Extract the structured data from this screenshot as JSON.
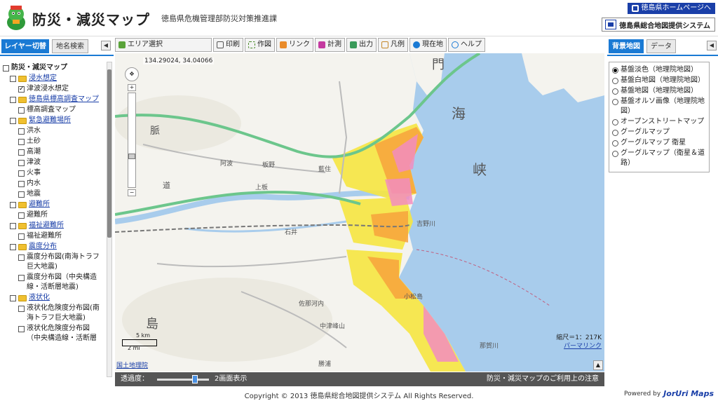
{
  "header": {
    "app_title": "防災・減災マップ",
    "department": "徳島県危機管理部防災対策推進課",
    "home_link": "徳島県ホームページへ",
    "gis_banner": "徳島県総合地図提供システム"
  },
  "left_tabs": {
    "layer_switch": "レイヤー切替",
    "place_search": "地名検索",
    "collapse": "◀"
  },
  "layer_tree": [
    {
      "label": "防災・減災マップ",
      "level": 0,
      "type": "checkbox",
      "checked": false,
      "link": false
    },
    {
      "label": "浸水想定",
      "level": 1,
      "type": "folder",
      "checked": false,
      "link": true
    },
    {
      "label": "津波浸水想定",
      "level": 2,
      "type": "checkbox",
      "checked": true,
      "link": false
    },
    {
      "label": "徳島県標高調査マップ",
      "level": 1,
      "type": "folder",
      "checked": false,
      "link": true
    },
    {
      "label": "標高調査マップ",
      "level": 2,
      "type": "checkbox",
      "checked": false,
      "link": false
    },
    {
      "label": "緊急避難場所",
      "level": 1,
      "type": "folder",
      "checked": false,
      "link": true
    },
    {
      "label": "洪水",
      "level": 2,
      "type": "checkbox",
      "checked": false,
      "link": false
    },
    {
      "label": "土砂",
      "level": 2,
      "type": "checkbox",
      "checked": false,
      "link": false
    },
    {
      "label": "高潮",
      "level": 2,
      "type": "checkbox",
      "checked": false,
      "link": false
    },
    {
      "label": "津波",
      "level": 2,
      "type": "checkbox",
      "checked": false,
      "link": false
    },
    {
      "label": "火事",
      "level": 2,
      "type": "checkbox",
      "checked": false,
      "link": false
    },
    {
      "label": "内水",
      "level": 2,
      "type": "checkbox",
      "checked": false,
      "link": false
    },
    {
      "label": "地震",
      "level": 2,
      "type": "checkbox",
      "checked": false,
      "link": false
    },
    {
      "label": "避難所",
      "level": 1,
      "type": "folder",
      "checked": false,
      "link": true
    },
    {
      "label": "避難所",
      "level": 2,
      "type": "checkbox",
      "checked": false,
      "link": false
    },
    {
      "label": "福祉避難所",
      "level": 1,
      "type": "folder",
      "checked": false,
      "link": true
    },
    {
      "label": "福祉避難所",
      "level": 2,
      "type": "checkbox",
      "checked": false,
      "link": false
    },
    {
      "label": "震度分布",
      "level": 1,
      "type": "folder",
      "checked": false,
      "link": true
    },
    {
      "label": "震度分布図(南海トラフ巨大地震)",
      "level": 2,
      "type": "checkbox",
      "checked": false,
      "link": false
    },
    {
      "label": "震度分布図（中央構造線・活断層地震)",
      "level": 2,
      "type": "checkbox",
      "checked": false,
      "link": false
    },
    {
      "label": "液状化",
      "level": 1,
      "type": "folder",
      "checked": false,
      "link": true
    },
    {
      "label": "液状化危険度分布図(南海トラフ巨大地震)",
      "level": 2,
      "type": "checkbox",
      "checked": false,
      "link": false
    },
    {
      "label": "液状化危険度分布図（中央構造線・活断層",
      "level": 2,
      "type": "checkbox",
      "checked": false,
      "link": false
    }
  ],
  "toolbar": {
    "area_select": "エリア選択",
    "print": "印刷",
    "draw": "作図",
    "link": "リンク",
    "measure": "計測",
    "output": "出力",
    "legend": "凡例",
    "current_location": "現在地",
    "help": "ヘルプ"
  },
  "map": {
    "coordinates": "134.29024, 34.04066",
    "scale": "縮尺＝1：217K",
    "permalink": "パーマリンク",
    "credit": "国土地理院",
    "scale_km": "5 km",
    "scale_mi": "2 mi",
    "labels": [
      "脈",
      "道",
      "島",
      "海",
      "峡",
      "門",
      "吉野川",
      "佐那河内",
      "那賀川",
      "中津峰山",
      "石井",
      "板野",
      "上板",
      "小松島",
      "藍住",
      "阿波",
      "勝浦"
    ]
  },
  "statusbar": {
    "opacity": "透過度：",
    "opacity_value": 0.75,
    "split_view": "2画面表示",
    "notice": "防災・減災マップのご利用上の注意"
  },
  "right_tabs": {
    "background_map": "背景地図",
    "data": "データ",
    "collapse": "◀"
  },
  "background_options": [
    {
      "label": "基盤淡色（地理院地図）",
      "selected": true
    },
    {
      "label": "基盤白地図（地理院地図）",
      "selected": false
    },
    {
      "label": "基盤地図（地理院地図）",
      "selected": false
    },
    {
      "label": "基盤オルソ画像（地理院地図）",
      "selected": false
    },
    {
      "label": "オープンストリートマップ",
      "selected": false
    },
    {
      "label": "グーグルマップ",
      "selected": false
    },
    {
      "label": "グーグルマップ 衛星",
      "selected": false
    },
    {
      "label": "グーグルマップ（衛星＆道路）",
      "selected": false
    }
  ],
  "footer": {
    "copyright": "Copyright © 2013 徳島県総合地図提供システム All Rights Reserved.",
    "powered_by": "Powered by",
    "brand": "JorUri Maps"
  },
  "colors": {
    "accent_blue": "#1a7ad4",
    "header_link_blue": "#1a3fa8",
    "sea": "#a8ccec",
    "land": "#f4f3ee",
    "tsunami_yellow": "#f6e640",
    "tsunami_orange": "#f7a23c",
    "tsunami_pink": "#f28cc0",
    "road_green": "#6cc68c"
  }
}
